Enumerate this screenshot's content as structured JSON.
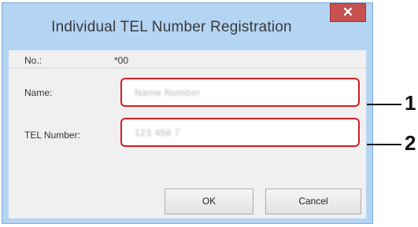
{
  "dialog": {
    "title": "Individual TEL Number Registration",
    "close_glyph": "✕",
    "close_icon": "close-icon"
  },
  "form": {
    "no_label": "No.:",
    "no_value": "*00",
    "name_label": "Name:",
    "name_value": "Name Number",
    "tel_label": "TEL Number:",
    "tel_value": "123 456 7"
  },
  "buttons": {
    "ok_label": "OK",
    "cancel_label": "Cancel"
  },
  "callouts": [
    "1",
    "2"
  ],
  "colors": {
    "title_bar": "#b4d4f4",
    "close_button": "#c75050",
    "highlight": "#d81b23"
  }
}
